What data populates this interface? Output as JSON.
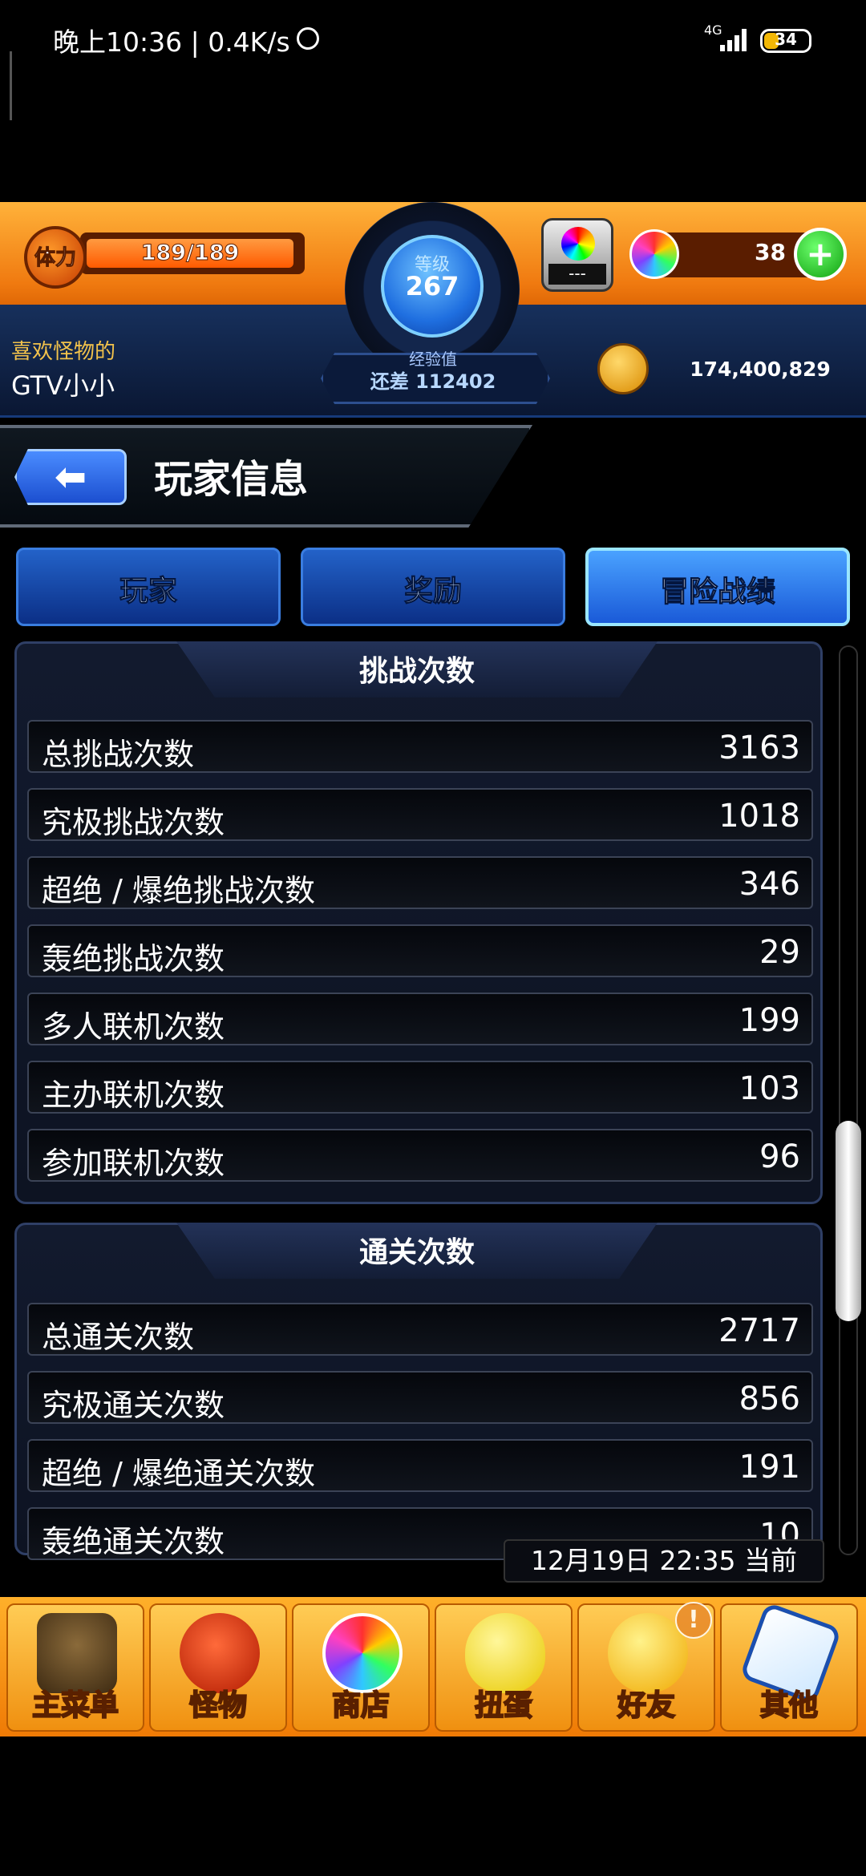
{
  "status_bar": {
    "time": "晚上10:36 | 0.4K/s",
    "network": "4G",
    "battery": "34"
  },
  "header": {
    "stamina_label": "体力",
    "stamina": "189/189",
    "level_label": "等级",
    "level": "267",
    "exp_label": "经验值",
    "exp_remaining": "还差 112402",
    "item_label": "---",
    "gems": "38",
    "add_gems": "+",
    "fav_monster_label": "喜欢怪物的",
    "player_name": "GTV小小",
    "coins": "174,400,829"
  },
  "page": {
    "back": "⬅",
    "title": "玩家信息"
  },
  "tabs": [
    {
      "label": "玩家",
      "active": false
    },
    {
      "label": "奖励",
      "active": false
    },
    {
      "label": "冒险战绩",
      "active": true
    }
  ],
  "challenge_section": {
    "title": "挑战次数",
    "rows": [
      {
        "label": "总挑战次数",
        "value": "3163"
      },
      {
        "label": "究极挑战次数",
        "value": "1018"
      },
      {
        "label": "超绝 / 爆绝挑战次数",
        "value": "346"
      },
      {
        "label": "轰绝挑战次数",
        "value": "29"
      },
      {
        "label": "多人联机次数",
        "value": "199"
      },
      {
        "label": "主办联机次数",
        "value": "103"
      },
      {
        "label": "参加联机次数",
        "value": "96"
      }
    ]
  },
  "clear_section": {
    "title": "通关次数",
    "rows": [
      {
        "label": "总通关次数",
        "value": "2717"
      },
      {
        "label": "究极通关次数",
        "value": "856"
      },
      {
        "label": "超绝 / 爆绝通关次数",
        "value": "191"
      },
      {
        "label": "轰绝通关次数",
        "value": "10"
      }
    ]
  },
  "timestamp": "12月19日 22:35 当前",
  "bottom_nav": [
    {
      "label": "主菜单",
      "icon": "castle-gate-icon"
    },
    {
      "label": "怪物",
      "icon": "monster-icon"
    },
    {
      "label": "商店",
      "icon": "rainbow-orb-icon"
    },
    {
      "label": "扭蛋",
      "icon": "egg-icon"
    },
    {
      "label": "好友",
      "icon": "friends-icon"
    },
    {
      "label": "其他",
      "icon": "question-icon"
    }
  ],
  "nav_badge": "!",
  "colors": {
    "header_orange": "#f07a10",
    "tab_blue": "#1a5ad8",
    "panel_dark": "#0d1322",
    "gold_text": "#f2c24b"
  }
}
